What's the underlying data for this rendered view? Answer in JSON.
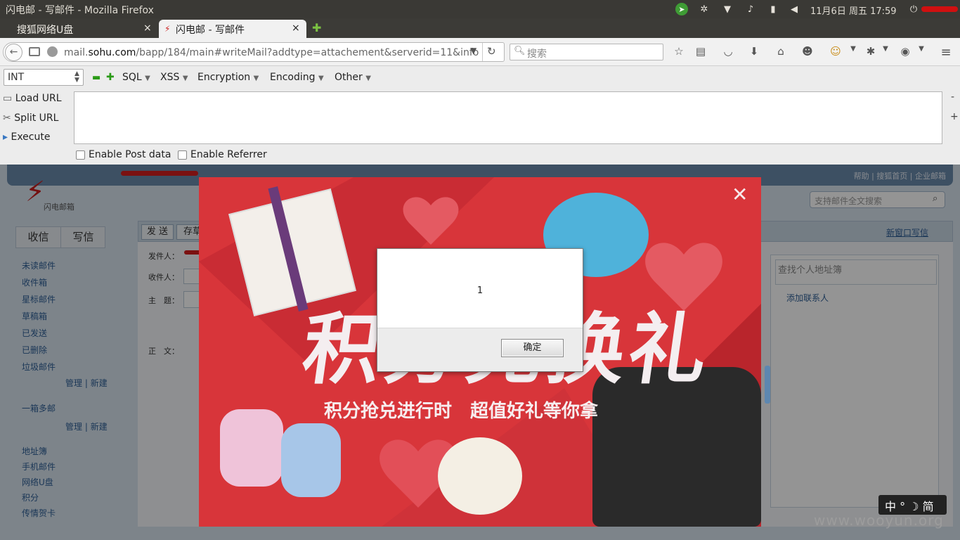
{
  "system_bar": {
    "window_title": "闪电邮 - 写邮件 - Mozilla Firefox",
    "clock": "11月6日 周五 17:59"
  },
  "tabs": [
    {
      "label": "搜狐网络U盘",
      "close": "×"
    },
    {
      "label": "闪电邮 - 写邮件",
      "close": "×"
    }
  ],
  "new_tab": "✚",
  "navbar": {
    "url_prefix": "mail.",
    "url_domain": "sohu.com",
    "url_rest": "/bapp/184/main#writeMail?addtype=attachement&serverid=11&info",
    "search_placeholder": "搜索"
  },
  "hackbar": {
    "select_value": "INT",
    "menus": [
      "SQL",
      "XSS",
      "Encryption",
      "Encoding",
      "Other"
    ],
    "load_url": "Load URL",
    "split_url": "Split URL",
    "execute": "Execute",
    "enable_post": "Enable Post data",
    "enable_referrer": "Enable Referrer",
    "minus_right": "-",
    "plus_right": "+"
  },
  "mail": {
    "logo_text": "闪电邮箱",
    "top_links": "帮助 | 搜狐首页 | 企业邮箱",
    "search_placeholder": "支持邮件全文搜索",
    "btn_inbox": "收信",
    "btn_compose": "写信",
    "btn_send": "发 送",
    "btn_save": "存草",
    "new_window": "新窗口写信",
    "folders": [
      "未读邮件",
      "收件箱",
      "星标邮件",
      "草稿箱",
      "已发送",
      "已删除",
      "垃圾邮件"
    ],
    "manage": "管理",
    "new": "新建",
    "multi": "一箱多邮",
    "extras": [
      "地址簿",
      "手机邮件",
      "网络U盘",
      "积分",
      "传情贺卡"
    ],
    "field_from": "发件人：",
    "field_to": "收件人：",
    "field_subject": "主　题：",
    "field_body": "正　文：",
    "addr_search": "查找个人地址簿",
    "add_contact": "添加联系人"
  },
  "promo": {
    "headline": "积分兑换礼",
    "subline": "积分抢兑进行时　超值好礼等你拿",
    "close": "✕"
  },
  "dialog": {
    "message": "1",
    "ok": "确定"
  },
  "ime": {
    "text": "中 ° ☽ 简"
  },
  "watermark": "www.wooyun.org",
  "colors": {
    "promo_red": "#d8353a",
    "firefox_chrome": "#f1f1f1",
    "ubuntu_bar": "#3a3935"
  }
}
